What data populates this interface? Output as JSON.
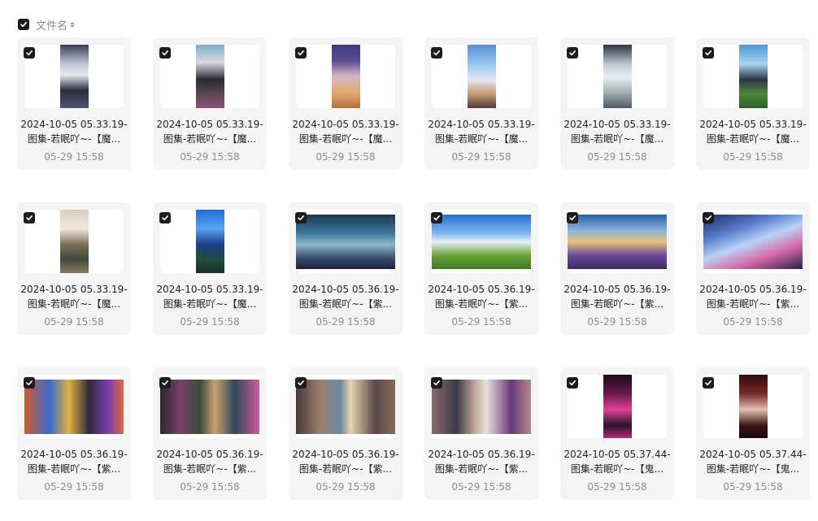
{
  "header": {
    "label": "文件名"
  },
  "files": [
    {
      "name_line1": "2024-10-05 05.33.19-",
      "name_line2": "图集-若眠吖~-【魔...",
      "date": "05-29 15:58",
      "thumb": "portrait",
      "art": "a1"
    },
    {
      "name_line1": "2024-10-05 05.33.19-",
      "name_line2": "图集-若眠吖~-【魔...",
      "date": "05-29 15:58",
      "thumb": "portrait",
      "art": "a2"
    },
    {
      "name_line1": "2024-10-05 05.33.19-",
      "name_line2": "图集-若眠吖~-【魔...",
      "date": "05-29 15:58",
      "thumb": "portrait",
      "art": "a3"
    },
    {
      "name_line1": "2024-10-05 05.33.19-",
      "name_line2": "图集-若眠吖~-【魔...",
      "date": "05-29 15:58",
      "thumb": "portrait",
      "art": "a4"
    },
    {
      "name_line1": "2024-10-05 05.33.19-",
      "name_line2": "图集-若眠吖~-【魔...",
      "date": "05-29 15:58",
      "thumb": "portrait",
      "art": "a5"
    },
    {
      "name_line1": "2024-10-05 05.33.19-",
      "name_line2": "图集-若眠吖~-【魔...",
      "date": "05-29 15:58",
      "thumb": "portrait",
      "art": "a6"
    },
    {
      "name_line1": "2024-10-05 05.33.19-",
      "name_line2": "图集-若眠吖~-【魔...",
      "date": "05-29 15:58",
      "thumb": "portrait",
      "art": "a7"
    },
    {
      "name_line1": "2024-10-05 05.33.19-",
      "name_line2": "图集-若眠吖~-【魔...",
      "date": "05-29 15:58",
      "thumb": "portrait",
      "art": "a8"
    },
    {
      "name_line1": "2024-10-05 05.36.19-",
      "name_line2": "图集-若眠吖~-【紫...",
      "date": "05-29 15:58",
      "thumb": "landscape",
      "art": "b1"
    },
    {
      "name_line1": "2024-10-05 05.36.19-",
      "name_line2": "图集-若眠吖~-【紫...",
      "date": "05-29 15:58",
      "thumb": "landscape",
      "art": "b2"
    },
    {
      "name_line1": "2024-10-05 05.36.19-",
      "name_line2": "图集-若眠吖~-【紫...",
      "date": "05-29 15:58",
      "thumb": "landscape",
      "art": "b3"
    },
    {
      "name_line1": "2024-10-05 05.36.19-",
      "name_line2": "图集-若眠吖~-【紫...",
      "date": "05-29 15:58",
      "thumb": "landscape",
      "art": "b4"
    },
    {
      "name_line1": "2024-10-05 05.36.19-",
      "name_line2": "图集-若眠吖~-【紫...",
      "date": "05-29 15:58",
      "thumb": "landscape",
      "art": "c1"
    },
    {
      "name_line1": "2024-10-05 05.36.19-",
      "name_line2": "图集-若眠吖~-【紫...",
      "date": "05-29 15:58",
      "thumb": "landscape",
      "art": "c2"
    },
    {
      "name_line1": "2024-10-05 05.36.19-",
      "name_line2": "图集-若眠吖~-【紫...",
      "date": "05-29 15:58",
      "thumb": "landscape",
      "art": "c3"
    },
    {
      "name_line1": "2024-10-05 05.36.19-",
      "name_line2": "图集-若眠吖~-【紫...",
      "date": "05-29 15:58",
      "thumb": "landscape",
      "art": "c4"
    },
    {
      "name_line1": "2024-10-05 05.37.44-",
      "name_line2": "图集-若眠吖~-【鬼...",
      "date": "05-29 15:58",
      "thumb": "portrait",
      "art": "d1"
    },
    {
      "name_line1": "2024-10-05 05.37.44-",
      "name_line2": "图集-若眠吖~-【鬼...",
      "date": "05-29 15:58",
      "thumb": "portrait",
      "art": "d2"
    }
  ]
}
